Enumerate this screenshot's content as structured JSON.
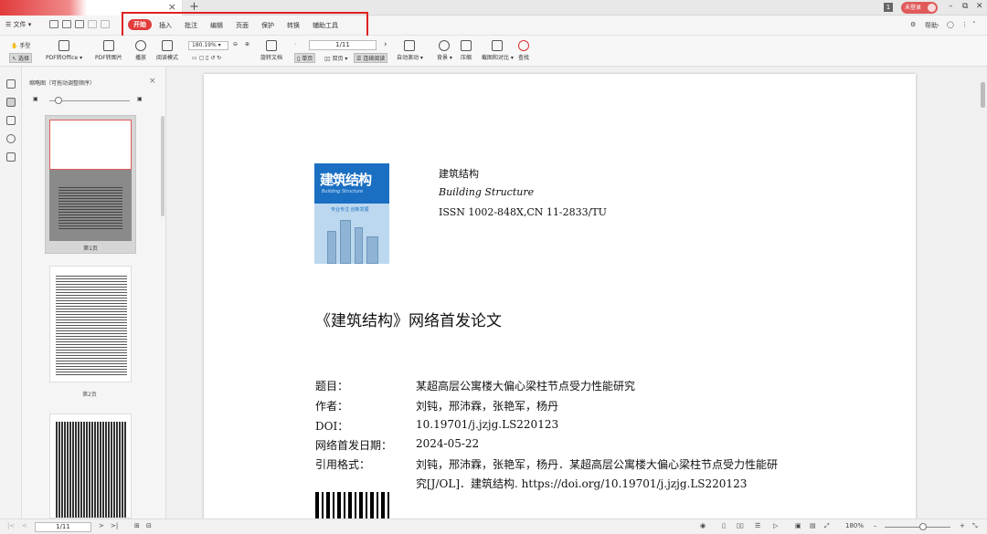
{
  "tabbar": {
    "close": "×",
    "new_tab": "+",
    "badge_box": "1",
    "user_label": "未登录",
    "controls": [
      "–",
      "⧉",
      "✕"
    ]
  },
  "menubar": {
    "file": "☰ 文件 ▾",
    "tabs": [
      "开始",
      "插入",
      "批注",
      "编辑",
      "页面",
      "保护",
      "转换",
      "辅助工具"
    ],
    "right": [
      "帮助·"
    ]
  },
  "ribbon": {
    "hand": "手型",
    "select": "选择",
    "pdf_office": "PDF转Office ▾",
    "pdf_image": "PDF转图片",
    "play": "播放",
    "read_mode": "阅读模式",
    "zoom": "180.19%",
    "rotate": "旋转文档",
    "page_input": "1/11",
    "single": "单页",
    "double": "双页 ▾",
    "continuous": "连续阅读",
    "auto_scroll": "自动滚动 ▾",
    "background": "背景 ▾",
    "compress": "压缩",
    "screenshot_compare": "截图和对比 ▾",
    "find": "查找"
  },
  "thumbnails": {
    "title": "缩略图（可拖动调整顺序）",
    "close": "×",
    "pages": [
      "第1页",
      "第2页"
    ]
  },
  "document": {
    "journal_cn": "建筑结构",
    "journal_en": "Building Structure",
    "issn": "ISSN 1002-848X,CN 11-2833/TU",
    "cover_title": "建筑结构",
    "cover_en": "Building Structure",
    "cover_slogan": "专业专注    创新发展",
    "heading": "《建筑结构》网络首发论文",
    "rows": [
      {
        "label": "题目：",
        "value": "某超高层公寓楼大偏心梁柱节点受力性能研究"
      },
      {
        "label": "作者：",
        "value": "刘钝，邢沛霖，张艳军，杨丹"
      },
      {
        "label": "DOI：",
        "value": "10.19701/j.jzjg.LS220123"
      },
      {
        "label": "网络首发日期：",
        "value": "2024-05-22"
      },
      {
        "label": "引用格式：",
        "value": "刘钝，邢沛霖，张艳军，杨丹．某超高层公寓楼大偏心梁柱节点受力性能研"
      }
    ],
    "cite_cont": "究[J/OL]．建筑结构. https://doi.org/10.19701/j.jzjg.LS220123"
  },
  "statusbar": {
    "page": "1/11",
    "zoom": "180%",
    "nav_first": "|<",
    "nav_prev": "<",
    "nav_next": ">",
    "nav_last": ">|",
    "minus": "–",
    "plus": "+"
  }
}
